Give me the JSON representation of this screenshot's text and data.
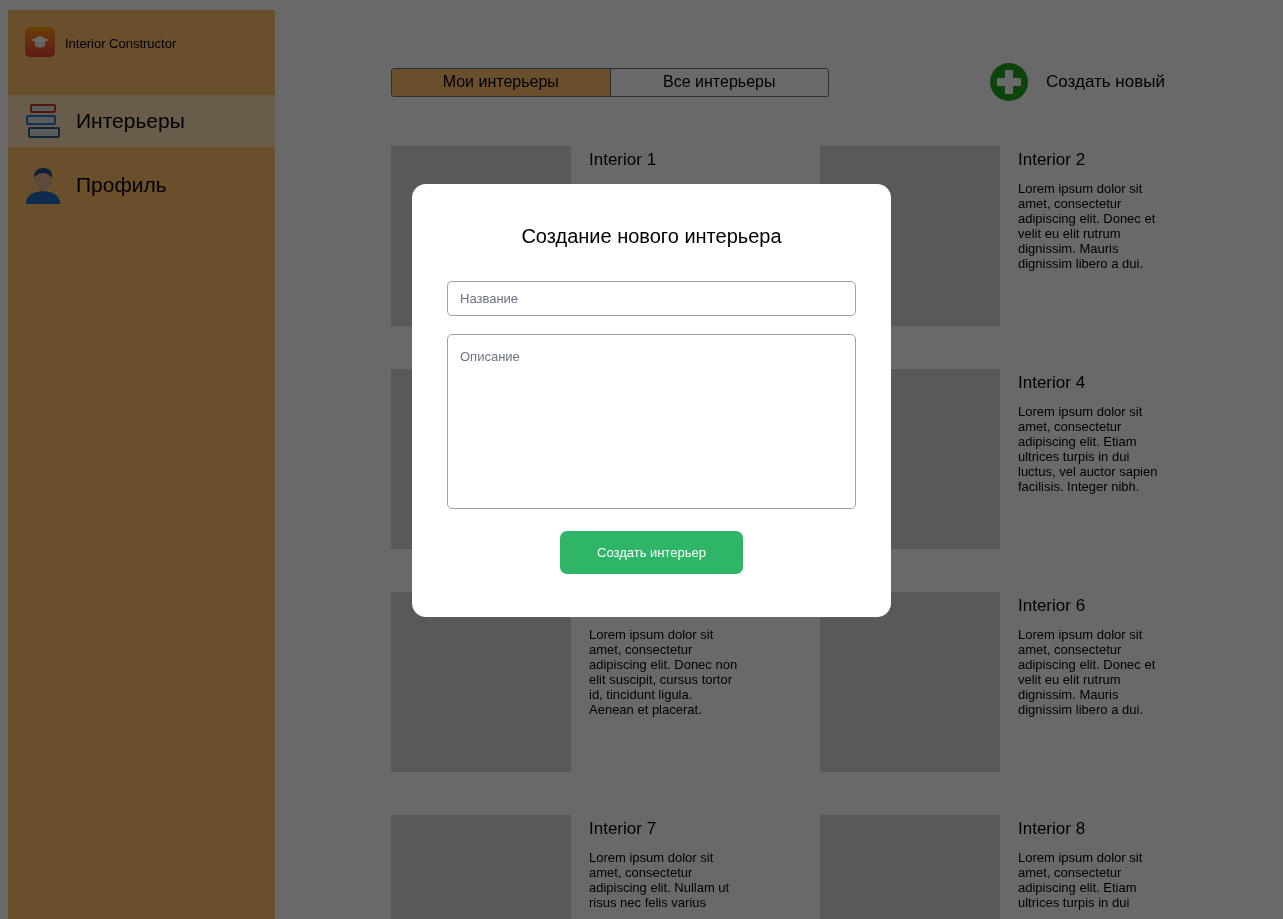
{
  "app": {
    "title": "Interior Constructor"
  },
  "sidebar": {
    "items": [
      {
        "label": "Интерьеры",
        "selected": true
      },
      {
        "label": "Профиль",
        "selected": false
      }
    ]
  },
  "tabs": [
    {
      "label": "Мои интерьеры",
      "selected": true
    },
    {
      "label": "Все интерьеры",
      "selected": false
    }
  ],
  "create_button": {
    "label": "Создать новый"
  },
  "card_rows": [
    {
      "cards": [
        {
          "kind": "card",
          "title": "Interior 1"
        },
        {
          "kind": "card",
          "title": "Interior 2",
          "description": "Lorem ipsum dolor sit amet, consectetur adipiscing elit. Donec et velit eu elit rutrum dignissim. Mauris dignissim libero a dui."
        }
      ]
    },
    {
      "cards": [
        {
          "kind": "card"
        },
        {
          "kind": "card",
          "title": "Interior 4",
          "description": "Lorem ipsum dolor sit amet, consectetur adipiscing elit. Etiam ultrices turpis in dui luctus, vel auctor sapien facilisis. Integer nibh."
        }
      ]
    },
    {
      "cards": [
        {
          "kind": "card",
          "description": "Lorem ipsum dolor sit amet, consectetur adipiscing elit. Donec non elit suscipit, cursus tortor id, tincidunt ligula. Aenean et placerat."
        },
        {
          "kind": "card",
          "title": "Interior 6",
          "description": "Lorem ipsum dolor sit amet, consectetur adipiscing elit. Donec et velit eu elit rutrum dignissim. Mauris dignissim libero a dui."
        }
      ]
    },
    {
      "cards": [
        {
          "kind": "card",
          "title": "Interior 7",
          "description": "Lorem ipsum dolor sit amet, consectetur adipiscing elit. Nullam ut risus nec felis varius"
        },
        {
          "kind": "card",
          "title": "Interior 8",
          "description": "Lorem ipsum dolor sit amet, consectetur adipiscing elit. Etiam ultrices turpis in dui"
        }
      ]
    }
  ],
  "dialog": {
    "title": "Создание нового интерьера",
    "name_field": {
      "placeholder": "Название"
    },
    "description_field": {
      "placeholder": "Описание"
    },
    "submit_button": {
      "label": "Создать интерьер"
    }
  }
}
